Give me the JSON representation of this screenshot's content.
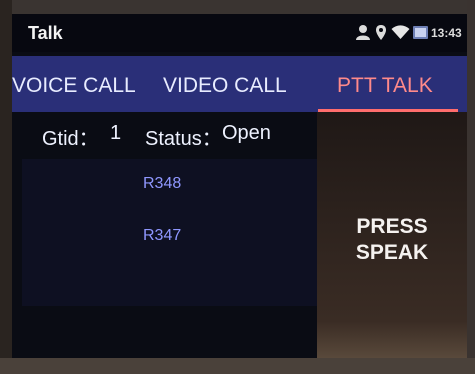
{
  "status_bar": {
    "app_title": "Talk",
    "time": "13:43",
    "icons": [
      "person-icon",
      "location-icon",
      "wifi-icon",
      "battery-icon"
    ]
  },
  "tabs": [
    {
      "label": "VOICE CALL",
      "active": false
    },
    {
      "label": "VIDEO CALL",
      "active": false
    },
    {
      "label": "PTT TALK",
      "active": true
    }
  ],
  "group_info": {
    "gtid_label": "Gtid：",
    "gtid_value": "1",
    "status_label": "Status：",
    "status_value": "Open"
  },
  "members": [
    "R348",
    "R347"
  ],
  "press_speak": {
    "line1": "PRESS",
    "line2": "SPEAK"
  },
  "colors": {
    "tab_bar": "#2a2f78",
    "active_tab": "#ff8a8a",
    "member_text": "#8f97ff",
    "screen_bg": "#0a0c14"
  }
}
